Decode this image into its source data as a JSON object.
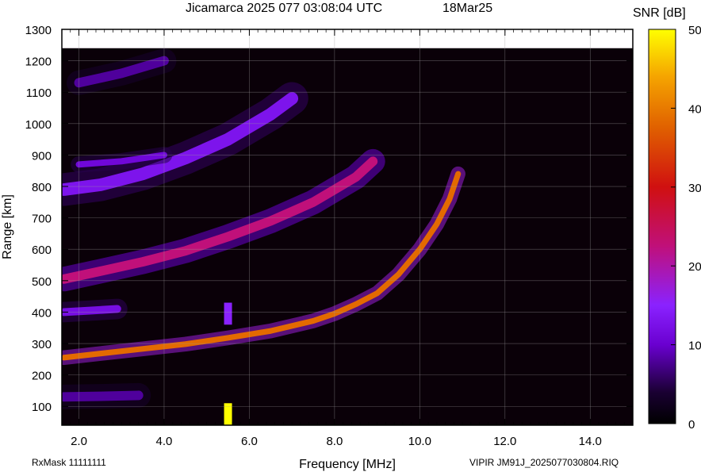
{
  "header": {
    "title": "Jicamarca 2025 077 03:08:04 UTC",
    "date": "18Mar25"
  },
  "footer": {
    "left": "RxMask 11111111",
    "right": "VIPIR  JM91J_2025077030804.RIQ"
  },
  "colorbar": {
    "label": "SNR [dB]",
    "min": 0,
    "max": 50,
    "ticks": [
      0,
      10,
      20,
      30,
      40,
      50
    ]
  },
  "chart_data": {
    "type": "heatmap",
    "title": "Jicamarca 2025 077 03:08:04 UTC",
    "xlabel": "Frequency [MHz]",
    "ylabel": "Range [km]",
    "xlim": [
      1.6,
      15.0
    ],
    "ylim": [
      40,
      1300
    ],
    "xticks": [
      2.0,
      4.0,
      6.0,
      8.0,
      10.0,
      12.0,
      14.0
    ],
    "xtick_labels": [
      "2.0",
      "4.0",
      "6.0",
      "8.0",
      "10.0",
      "12.0",
      "14.0"
    ],
    "yticks": [
      100,
      200,
      300,
      400,
      500,
      600,
      700,
      800,
      900,
      1000,
      1100,
      1200,
      1300
    ],
    "grid": true,
    "data_top_km": 1240,
    "traces": [
      {
        "name": "F-region trace (1 hop)",
        "snr_db": 38,
        "width_km": 18,
        "points": [
          [
            1.65,
            255
          ],
          [
            2.5,
            268
          ],
          [
            3.5,
            283
          ],
          [
            4.5,
            298
          ],
          [
            5.5,
            318
          ],
          [
            6.5,
            340
          ],
          [
            7.5,
            372
          ],
          [
            8.0,
            395
          ],
          [
            8.5,
            425
          ],
          [
            9.0,
            460
          ],
          [
            9.5,
            520
          ],
          [
            10.0,
            600
          ],
          [
            10.4,
            680
          ],
          [
            10.7,
            760
          ],
          [
            10.9,
            840
          ]
        ]
      },
      {
        "name": "F-region trace (2 hop)",
        "snr_db": 22,
        "width_km": 30,
        "points": [
          [
            1.65,
            505
          ],
          [
            2.5,
            530
          ],
          [
            3.5,
            560
          ],
          [
            4.5,
            595
          ],
          [
            5.5,
            640
          ],
          [
            6.5,
            690
          ],
          [
            7.5,
            750
          ],
          [
            8.5,
            830
          ],
          [
            8.9,
            880
          ]
        ]
      },
      {
        "name": "F-region trace (3 hop)",
        "snr_db": 13,
        "width_km": 40,
        "points": [
          [
            1.65,
            790
          ],
          [
            2.5,
            805
          ],
          [
            3.5,
            840
          ],
          [
            4.5,
            890
          ],
          [
            5.5,
            950
          ],
          [
            6.5,
            1030
          ],
          [
            7.0,
            1080
          ]
        ]
      },
      {
        "name": "E/low echo",
        "snr_db": 12,
        "width_km": 25,
        "points": [
          [
            1.65,
            400
          ],
          [
            2.3,
            405
          ],
          [
            2.9,
            410
          ]
        ]
      },
      {
        "name": "low range echo",
        "snr_db": 8,
        "width_km": 30,
        "points": [
          [
            1.65,
            130
          ],
          [
            2.5,
            132
          ],
          [
            3.4,
            135
          ]
        ]
      },
      {
        "name": "high range echo",
        "snr_db": 11,
        "width_km": 20,
        "points": [
          [
            2.0,
            870
          ],
          [
            3.0,
            880
          ],
          [
            4.0,
            900
          ]
        ]
      },
      {
        "name": "upper faint echo",
        "snr_db": 8,
        "width_km": 30,
        "points": [
          [
            2.0,
            1130
          ],
          [
            3.0,
            1160
          ],
          [
            4.0,
            1200
          ]
        ]
      }
    ],
    "interference": [
      {
        "freq_mhz": 5.5,
        "range_km": [
          40,
          110
        ],
        "snr_db": 50
      },
      {
        "freq_mhz": 5.5,
        "range_km": [
          360,
          430
        ],
        "snr_db": 15
      }
    ]
  }
}
